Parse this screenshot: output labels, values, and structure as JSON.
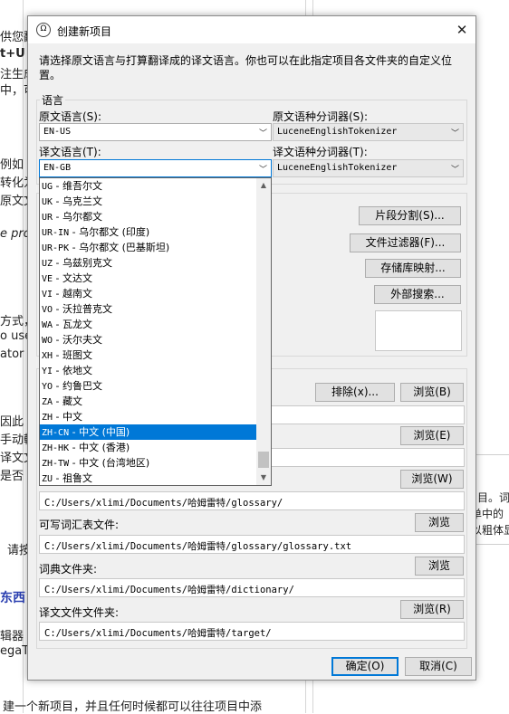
{
  "background": {
    "fragments": [
      "供您翻",
      "t+U",
      "注生成",
      "中，可",
      "例如 M",
      "转化为",
      "原文文",
      "e pro",
      "方式，",
      "o use",
      "ator",
      "因此",
      "手动輸",
      "译文文",
      "是否",
      "请按",
      "东西",
      "辑器",
      "egaT",
      "建一个新项目，并且任何时候都可以往往项目中添"
    ],
    "right_fragments": [
      "目。词",
      "单中的",
      "以粗体显"
    ]
  },
  "dialog": {
    "title": "创建新项目",
    "close_glyph": "✕",
    "instructions": "请选择原文语言与打算翻译成的译文语言。你也可以在此指定项目各文件夹的自定义位置。",
    "language_group_label": "语言",
    "source_language_label": "原文语言(S):",
    "source_language_value": "EN-US",
    "source_tokenizer_label": "原文语种分词器(S):",
    "source_tokenizer_value": "LuceneEnglishTokenizer",
    "target_language_label": "译文语言(T):",
    "target_language_value": "EN-GB",
    "target_tokenizer_label": "译文语种分词器(T):",
    "target_tokenizer_value": "LuceneEnglishTokenizer",
    "buttons": {
      "segmentation": "片段分割(S)...",
      "file_filters": "文件过滤器(F)...",
      "repository_mapping": "存储库映射...",
      "external_search": "外部搜索...",
      "exclude": "排除(x)...",
      "browse_1": "浏览(B)",
      "browse_2": "浏览(E)",
      "browse_3": "浏览(W)",
      "browse_4": "浏览",
      "browse_5": "浏览",
      "browse_6": "浏览(R)",
      "ok": "确定(O)",
      "cancel": "取消(C)"
    },
    "glossary_path": "C:/Users/xlimi/Documents/哈姆雷特/glossary/",
    "writable_glossary_label": "可写词汇表文件:",
    "writable_glossary_path": "C:/Users/xlimi/Documents/哈姆雷特/glossary/glossary.txt",
    "dictionary_folder_label": "词典文件夹:",
    "dictionary_path": "C:/Users/xlimi/Documents/哈姆雷特/dictionary/",
    "target_folder_label": "译文文件文件夹:",
    "target_path": "C:/Users/xlimi/Documents/哈姆雷特/target/"
  },
  "dropdown": {
    "selected_index": 16,
    "options": [
      {
        "code": "UG",
        "name": "维吾尔文"
      },
      {
        "code": "UK",
        "name": "乌克兰文"
      },
      {
        "code": "UR",
        "name": "乌尔都文"
      },
      {
        "code": "UR-IN",
        "name": "乌尔都文 (印度)"
      },
      {
        "code": "UR-PK",
        "name": "乌尔都文 (巴基斯坦)"
      },
      {
        "code": "UZ",
        "name": "乌兹别克文"
      },
      {
        "code": "VE",
        "name": "文达文"
      },
      {
        "code": "VI",
        "name": "越南文"
      },
      {
        "code": "VO",
        "name": "沃拉普克文"
      },
      {
        "code": "WA",
        "name": "瓦龙文"
      },
      {
        "code": "WO",
        "name": "沃尔夫文"
      },
      {
        "code": "XH",
        "name": "班图文"
      },
      {
        "code": "YI",
        "name": "依地文"
      },
      {
        "code": "YO",
        "name": "约鲁巴文"
      },
      {
        "code": "ZA",
        "name": "藏文"
      },
      {
        "code": "ZH",
        "name": "中文"
      },
      {
        "code": "ZH-CN",
        "name": "中文 (中国)"
      },
      {
        "code": "ZH-HK",
        "name": "中文 (香港)"
      },
      {
        "code": "ZH-TW",
        "name": "中文 (台湾地区)"
      },
      {
        "code": "ZU",
        "name": "祖鲁文"
      }
    ],
    "separator": " - "
  }
}
